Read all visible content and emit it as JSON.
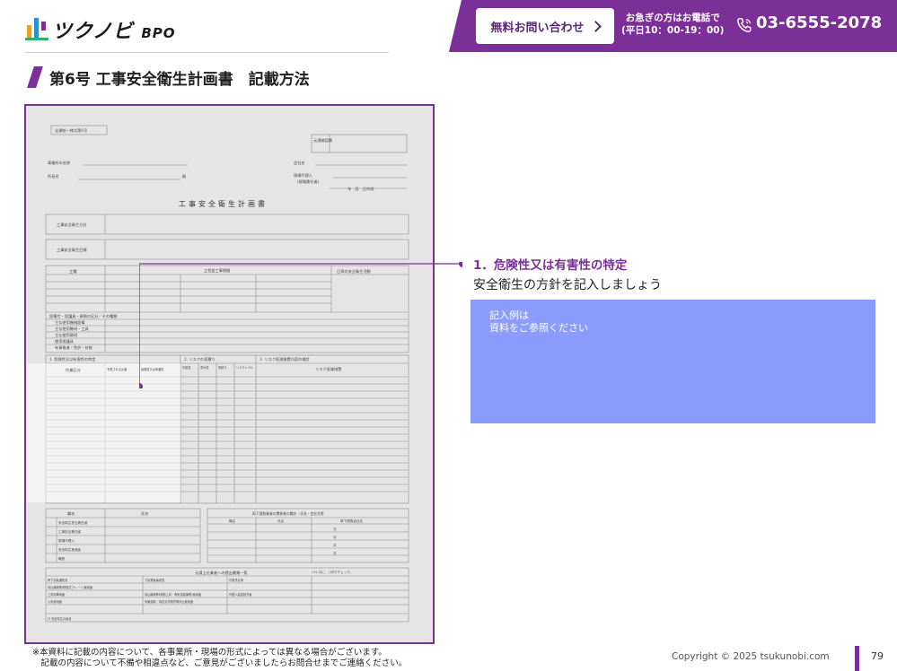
{
  "header": {
    "logo_text": "ツクノビ",
    "logo_sub": "BPO",
    "contact_button": "無料お問い合わせ",
    "urgent_line1": "お急ぎの方はお電話で",
    "urgent_line2": "(平日10：00-19：00)",
    "phone": "03-6555-2078"
  },
  "title": "第6号 工事安全衛生計画書　記載方法",
  "document": {
    "form_label": "全建統一様式第6号",
    "confirm_label": "元請確認欄",
    "office_label": "事業所の名称",
    "company_label": "会社名",
    "head_label": "所長名",
    "seal": "殿",
    "agent_label": "現場代理人",
    "agent_sub": "(現場責任者)",
    "date": "年　月　日作成",
    "main_title": "工事安全衛生計画書",
    "policy_label": "工事安全衛生方針",
    "goal_label": "工事安全衛生目標",
    "work_col": "工種",
    "process_col": "工程並工事期間",
    "daily_col": "日常の安全衛生活動",
    "equipment_label": "設備付・保護具・資格の区分／その種類",
    "eq_items": [
      "主な使用機械設備",
      "主な使用機材・工具",
      "主な使用資材",
      "使用保護具",
      "有資格者・免許・技能"
    ],
    "risk_sec1": "1. 危険性又は有害性の特定",
    "risk_sec2": "2. リスクの見積り",
    "risk_sec3": "3. リスク低減措置内容の検討",
    "risk_cols": [
      "作業区分",
      "予測される災害",
      "危険性又は有害性",
      "可能性",
      "重大性",
      "見積り",
      "リスクレベル",
      "リスク低減措置"
    ],
    "org_col1": "職名",
    "org_col2": "氏名",
    "org_right": "再下請負業者の関係者の職名・氏名・会社名等",
    "org_right_col1": "職名",
    "org_right_col2": "氏名",
    "org_right_col3": "再下請負会社名",
    "org_items": [
      "安全衛生担当責任者",
      "工事担当責任者",
      "現場代理人",
      "安全衛生推進者",
      "職長"
    ],
    "org_company": "次",
    "check_title": "元請上位業者への提出書類一覧",
    "check_note": "(※) 口に、○印でチェック。",
    "check_items": [
      "再下請負通知書",
      "下請業者編成表",
      "作業員名簿",
      "持込機械等(移動式クレーン)使用届",
      "工事用車両届",
      "持込機械等(電動工具・電気溶接機等)使用届",
      "外国人建設就労者",
      "火気使用届",
      "有機溶剤・特定化学物質等持込使用届",
      "安全衛生計画書"
    ],
    "check_misc": "口 安全衛生計画書"
  },
  "annotation": {
    "heading": "1．危険性又は有害性の特定",
    "subtext": "安全衛生の方針を記入しましょう",
    "example_text": "記入例は\n資料をご参照ください"
  },
  "footer": {
    "note": "※本資料に記載の内容について、各事業所・現場の形式によっては異なる場合がございます。\n　記載の内容について不備や相違点など、ご意見がございましたらお問合せまでご連絡ください。",
    "copyright": "Copyright © 2025 tsukunobi.com",
    "page_number": "79"
  },
  "colors": {
    "brand_purple": "#7b2f98",
    "example_box": "#8c9cfc"
  }
}
